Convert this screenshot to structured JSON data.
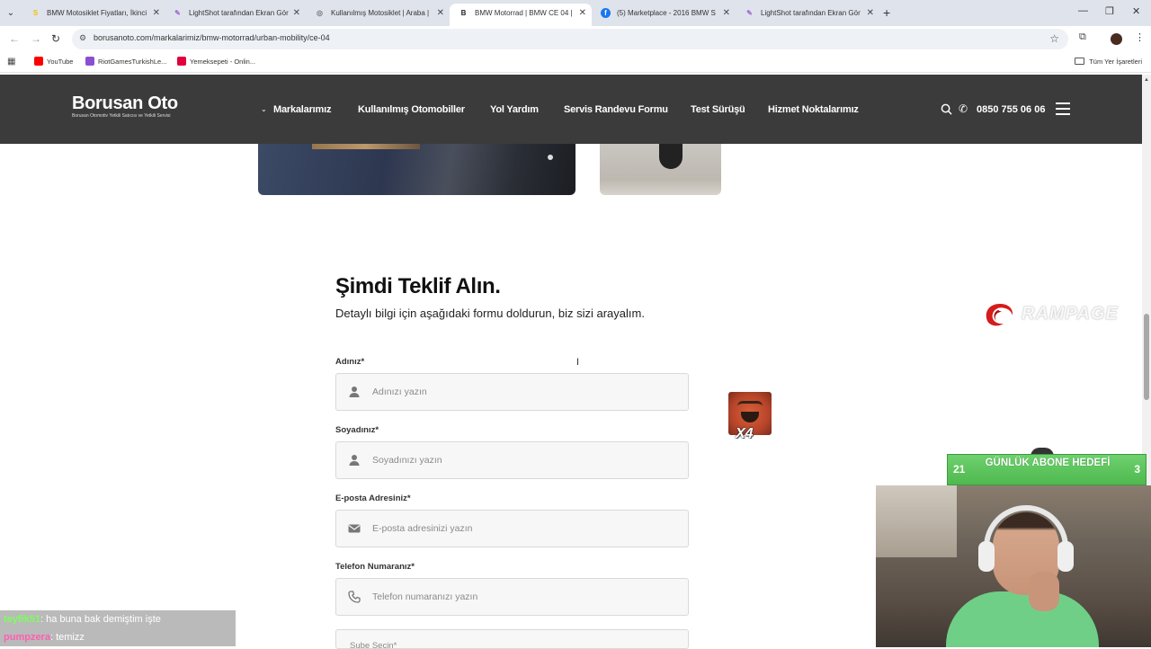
{
  "browser": {
    "tabs": [
      {
        "label": "BMW Motosiklet Fiyatları, İkinci",
        "favicon": "S",
        "favicon_color": "#f2c200"
      },
      {
        "label": "LightShot tarafından Ekran Gör",
        "favicon": "✎",
        "favicon_color": "#a36bd6"
      },
      {
        "label": "Kullanılmış Motosiklet | Araba |",
        "favicon": "◎",
        "favicon_color": "#777777"
      },
      {
        "label": "BMW Motorrad | BMW CE 04 |",
        "favicon": "B",
        "favicon_color": "#222222",
        "active": true
      },
      {
        "label": "(5) Marketplace - 2016 BMW S",
        "favicon": "f",
        "favicon_color": "#1877f2"
      },
      {
        "label": "LightShot tarafından Ekran Gör",
        "favicon": "✎",
        "favicon_color": "#a36bd6"
      }
    ],
    "url": "borusanoto.com/markalarimiz/bmw-motorrad/urban-mobility/ce-04",
    "bookmarks": [
      {
        "label": "YouTube",
        "color": "#ff0000"
      },
      {
        "label": "RiotGamesTurkishLe...",
        "color": "#8a4fd1"
      },
      {
        "label": "Yemeksepeti - Onlin...",
        "color": "#e0003c"
      }
    ],
    "all_bookmarks": "Tüm Yer İşaretleri"
  },
  "site": {
    "logo_main": "Borusan Oto",
    "logo_sub": "Borusan Otomotiv Yetkili Satıcısı ve Yetkili Servisi",
    "nav": [
      "Markalarımız",
      "Kullanılmış Otomobiller",
      "Yol Yardım",
      "Servis Randevu Formu",
      "Test Sürüşü",
      "Hizmet Noktalarımız"
    ],
    "phone": "0850 755 06 06",
    "header_color": "#3b3b3c"
  },
  "form": {
    "title": "Şimdi Teklif Alın.",
    "subtitle": "Detaylı bilgi için aşağıdaki formu doldurun, biz sizi arayalım.",
    "fields": [
      {
        "label": "Adınız*",
        "placeholder": "Adınızı yazın",
        "icon": "user-icon"
      },
      {
        "label": "Soyadınız*",
        "placeholder": "Soyadınızı yazın",
        "icon": "user-icon"
      },
      {
        "label": "E-posta Adresiniz*",
        "placeholder": "E-posta adresinizi yazın",
        "icon": "envelope-icon"
      },
      {
        "label": "Telefon Numaranız*",
        "placeholder": "Telefon numaranızı yazın",
        "icon": "phone-icon"
      }
    ],
    "partial_field": "Şube Seçin*"
  },
  "overlays": {
    "rampage_text": "RAMPAGE",
    "emote_count": "X4",
    "sub_goal": {
      "left": "21",
      "title": "GÜNLÜK ABONE HEDEFİ",
      "right": "3",
      "color": "#57c157"
    },
    "chat": [
      {
        "user": "teyfik51",
        "message": ": ha buna bak demiştim işte"
      },
      {
        "user": "pumpzera",
        "message": ": temizz"
      }
    ]
  }
}
